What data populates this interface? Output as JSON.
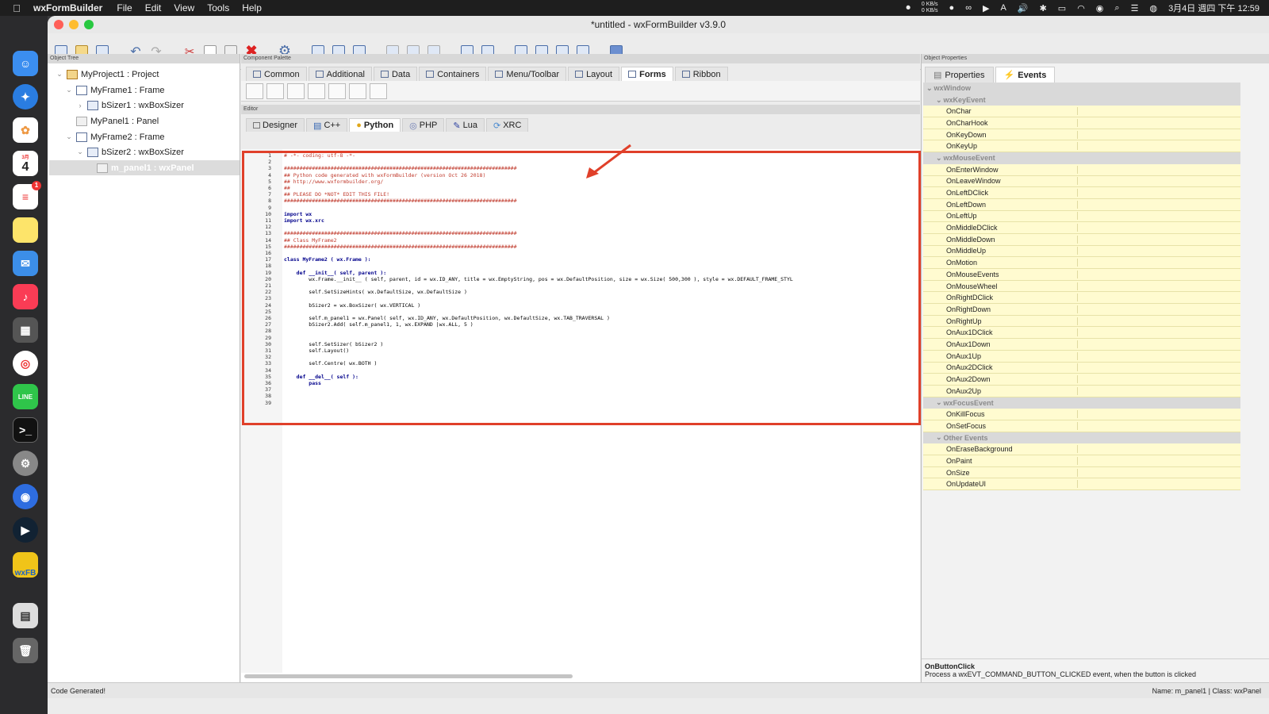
{
  "menubar": {
    "app_name": "wxFormBuilder",
    "menus": [
      "File",
      "Edit",
      "View",
      "Tools",
      "Help"
    ],
    "net_up": "0 KB/s",
    "net_down": "0 KB/s",
    "datetime": "3月4日 週四 下午 12:59"
  },
  "dock": {
    "icons": [
      "finder-icon",
      "safari-icon",
      "photos-icon",
      "calendar-icon",
      "reminders-icon",
      "notes-icon",
      "mail-icon",
      "music-icon",
      "calculator-icon",
      "chrome-icon",
      "line-icon",
      "terminal-icon",
      "system-preferences-icon",
      "app-icon",
      "quicktime-icon",
      "wxformbuilder-icon",
      "archive-icon",
      "trash-icon"
    ],
    "calendar_month": "3月",
    "calendar_day": "4",
    "reminders_badge": "1",
    "line_label": "LINE",
    "wxfb_label": "wxFB"
  },
  "window": {
    "title": "*untitled - wxFormBuilder v3.9.0"
  },
  "object_tree": {
    "label": "Object Tree",
    "items": [
      {
        "label": "MyProject1 : Project"
      },
      {
        "label": "MyFrame1 : Frame"
      },
      {
        "label": "bSizer1 : wxBoxSizer"
      },
      {
        "label": "MyPanel1 : Panel"
      },
      {
        "label": "MyFrame2 : Frame"
      },
      {
        "label": "bSizer2 : wxBoxSizer"
      },
      {
        "label": "m_panel1 : wxPanel"
      }
    ]
  },
  "palette": {
    "label": "Component Palette",
    "tabs": [
      "Common",
      "Additional",
      "Data",
      "Containers",
      "Menu/Toolbar",
      "Layout",
      "Forms",
      "Ribbon"
    ],
    "active_tab": "Forms"
  },
  "editor": {
    "label": "Editor",
    "tabs": [
      "Designer",
      "C++",
      "Python",
      "PHP",
      "Lua",
      "XRC"
    ],
    "active_tab": "Python",
    "lines": [
      "# -*- coding: utf-8 -*-",
      "",
      "###########################################################################",
      "## Python code generated with wxFormBuilder (version Oct 26 2018)",
      "## http://www.wxformbuilder.org/",
      "##",
      "## PLEASE DO *NOT* EDIT THIS FILE!",
      "###########################################################################",
      "",
      "import wx",
      "import wx.xrc",
      "",
      "###########################################################################",
      "## Class MyFrame2",
      "###########################################################################",
      "",
      "class MyFrame2 ( wx.Frame ):",
      "",
      "    def __init__( self, parent ):",
      "        wx.Frame.__init__ ( self, parent, id = wx.ID_ANY, title = wx.EmptyString, pos = wx.DefaultPosition, size = wx.Size( 500,300 ), style = wx.DEFAULT_FRAME_STYL",
      "",
      "        self.SetSizeHints( wx.DefaultSize, wx.DefaultSize )",
      "",
      "        bSizer2 = wx.BoxSizer( wx.VERTICAL )",
      "",
      "        self.m_panel1 = wx.Panel( self, wx.ID_ANY, wx.DefaultPosition, wx.DefaultSize, wx.TAB_TRAVERSAL )",
      "        bSizer2.Add( self.m_panel1, 1, wx.EXPAND |wx.ALL, 5 )",
      "",
      "",
      "        self.SetSizer( bSizer2 )",
      "        self.Layout()",
      "",
      "        self.Centre( wx.BOTH )",
      "",
      "    def __del__( self ):",
      "        pass",
      "",
      "",
      ""
    ]
  },
  "properties": {
    "label": "Object Properties",
    "tabs": [
      "Properties",
      "Events"
    ],
    "active_tab": "Events",
    "rows": [
      {
        "type": "root",
        "name": "wxWindow"
      },
      {
        "type": "cat",
        "name": "wxKeyEvent"
      },
      {
        "type": "ev",
        "name": "OnChar"
      },
      {
        "type": "ev",
        "name": "OnCharHook"
      },
      {
        "type": "ev",
        "name": "OnKeyDown"
      },
      {
        "type": "ev",
        "name": "OnKeyUp"
      },
      {
        "type": "cat",
        "name": "wxMouseEvent"
      },
      {
        "type": "ev",
        "name": "OnEnterWindow"
      },
      {
        "type": "ev",
        "name": "OnLeaveWindow"
      },
      {
        "type": "ev",
        "name": "OnLeftDClick"
      },
      {
        "type": "ev",
        "name": "OnLeftDown"
      },
      {
        "type": "ev",
        "name": "OnLeftUp"
      },
      {
        "type": "ev",
        "name": "OnMiddleDClick"
      },
      {
        "type": "ev",
        "name": "OnMiddleDown"
      },
      {
        "type": "ev",
        "name": "OnMiddleUp"
      },
      {
        "type": "ev",
        "name": "OnMotion"
      },
      {
        "type": "ev",
        "name": "OnMouseEvents"
      },
      {
        "type": "ev",
        "name": "OnMouseWheel"
      },
      {
        "type": "ev",
        "name": "OnRightDClick"
      },
      {
        "type": "ev",
        "name": "OnRightDown"
      },
      {
        "type": "ev",
        "name": "OnRightUp"
      },
      {
        "type": "ev",
        "name": "OnAux1DClick"
      },
      {
        "type": "ev",
        "name": "OnAux1Down"
      },
      {
        "type": "ev",
        "name": "OnAux1Up"
      },
      {
        "type": "ev",
        "name": "OnAux2DClick"
      },
      {
        "type": "ev",
        "name": "OnAux2Down"
      },
      {
        "type": "ev",
        "name": "OnAux2Up"
      },
      {
        "type": "cat",
        "name": "wxFocusEvent"
      },
      {
        "type": "ev",
        "name": "OnKillFocus"
      },
      {
        "type": "ev",
        "name": "OnSetFocus"
      },
      {
        "type": "cat",
        "name": "Other Events"
      },
      {
        "type": "ev",
        "name": "OnEraseBackground"
      },
      {
        "type": "ev",
        "name": "OnPaint"
      },
      {
        "type": "ev",
        "name": "OnSize"
      },
      {
        "type": "ev",
        "name": "OnUpdateUI"
      }
    ],
    "description_title": "OnButtonClick",
    "description_text": "Process a wxEVT_COMMAND_BUTTON_CLICKED event, when the button is clicked"
  },
  "status": {
    "left": "Code Generated!",
    "right": "Name: m_panel1 | Class: wxPanel"
  },
  "colors": {
    "highlight_border": "#e0402a",
    "event_row_bg": "#fffbd0",
    "category_row_bg": "#d9d9d9",
    "comment": "#c0392b",
    "keyword": "#00008b"
  }
}
